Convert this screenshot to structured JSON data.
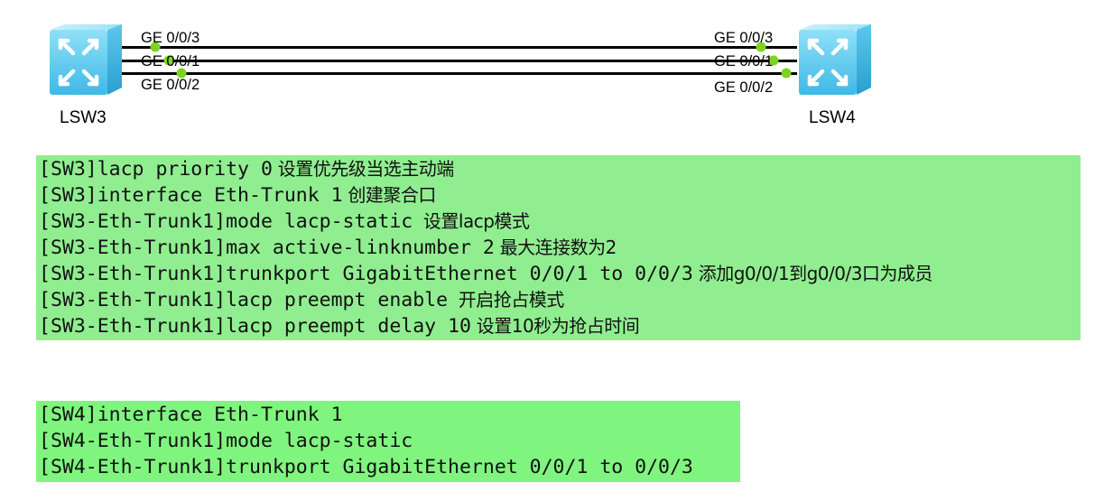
{
  "topology": {
    "devices": [
      {
        "name": "LSW3",
        "icon": "switch-icon"
      },
      {
        "name": "LSW4",
        "icon": "switch-icon"
      }
    ],
    "links": [
      {
        "left_port": "GE 0/0/3",
        "right_port": "GE 0/0/3"
      },
      {
        "left_port": "GE 0/0/1",
        "right_port": "GE 0/0/1"
      },
      {
        "left_port": "GE 0/0/2",
        "right_port": "GE 0/0/2"
      }
    ],
    "colors": {
      "switch_body": "#6fd3f2",
      "link_line": "#000000",
      "port_dot": "#7ed321"
    }
  },
  "sw3_block": {
    "background": "#90ee90",
    "lines": [
      {
        "command": "[SW3]lacp priority 0",
        "comment": " 设置优先级当选主动端"
      },
      {
        "command": "[SW3]interface Eth-Trunk 1",
        "comment": " 创建聚合口"
      },
      {
        "command": "[SW3-Eth-Trunk1]mode lacp-static",
        "comment": "  设置lacp模式"
      },
      {
        "command": "[SW3-Eth-Trunk1]max active-linknumber 2",
        "comment": " 最大连接数为2"
      },
      {
        "command": "[SW3-Eth-Trunk1]trunkport GigabitEthernet 0/0/1 to 0/0/3",
        "comment": " 添加g0/0/1到g0/0/3口为成员"
      },
      {
        "command": "[SW3-Eth-Trunk1]lacp preempt enable",
        "comment": "  开启抢占模式"
      },
      {
        "command": "[SW3-Eth-Trunk1]lacp preempt delay 10",
        "comment": " 设置10秒为抢占时间"
      }
    ]
  },
  "sw4_block": {
    "background": "#7ff57f",
    "lines": [
      {
        "command": "[SW4]interface Eth-Trunk 1"
      },
      {
        "command": "[SW4-Eth-Trunk1]mode lacp-static"
      },
      {
        "command": "[SW4-Eth-Trunk1]trunkport GigabitEthernet 0/0/1 to 0/0/3"
      }
    ]
  }
}
